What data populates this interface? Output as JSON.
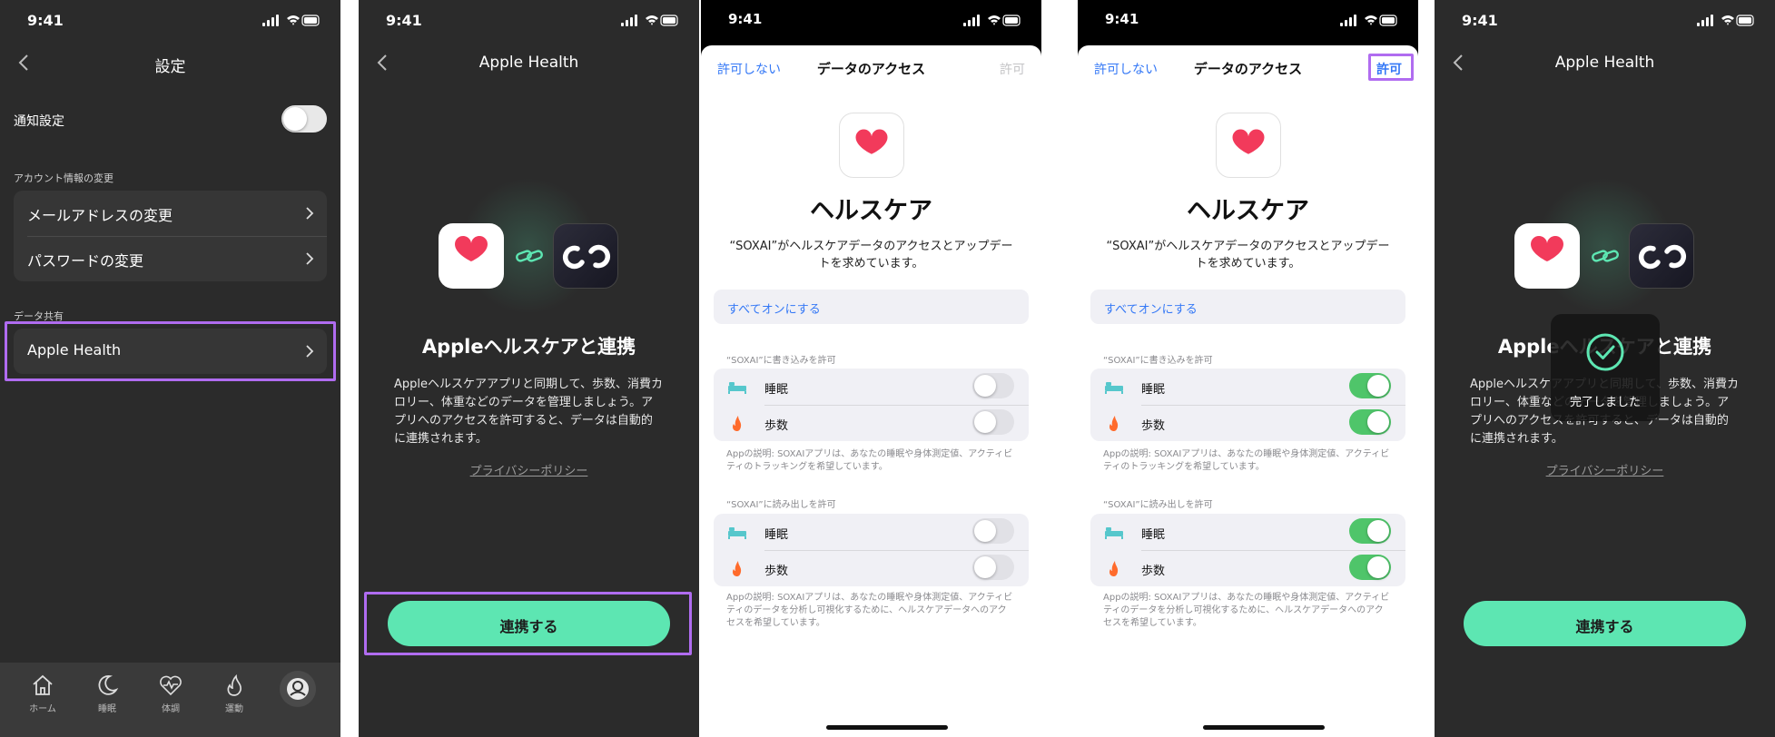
{
  "status": {
    "time": "9:41"
  },
  "colors": {
    "accent_green": "#5de6b2",
    "highlight": "#b06cf0",
    "ios_blue": "#3478f6",
    "switch_on": "#4fc56a"
  },
  "screen1": {
    "title": "設定",
    "notification_label": "通知設定",
    "notification_on": false,
    "account_section": "アカウント情報の変更",
    "email_change": "メールアドレスの変更",
    "password_change": "パスワードの変更",
    "data_share_section": "データ共有",
    "apple_health": "Apple Health",
    "tabs": [
      {
        "label": "ホーム",
        "icon": "home-icon"
      },
      {
        "label": "睡眠",
        "icon": "moon-icon"
      },
      {
        "label": "体調",
        "icon": "heart-pulse-icon"
      },
      {
        "label": "運動",
        "icon": "flame-icon"
      },
      {
        "label": "",
        "icon": "profile-icon"
      }
    ]
  },
  "link_screen": {
    "title": "Apple Health",
    "heading": "Appleヘルスケアと連携",
    "description": "Appleヘルスケアアプリと同期して、歩数、消費カロリー、体重などのデータを管理しましょう。アプリへのアクセスを許可すると、データは自動的に連携されます。",
    "privacy": "プライバシーポリシー",
    "button": "連携する"
  },
  "access_sheet": {
    "deny": "許可しない",
    "title": "データのアクセス",
    "allow": "許可",
    "app_title": "ヘルスケア",
    "subtitle": "“SOXAI”がヘルスケアデータのアクセスとアップデートを求めています。",
    "turn_all_on": "すべてオンにする",
    "write_header": "“SOXAI”に書き込みを許可",
    "read_header": "“SOXAI”に読み出しを許可",
    "sleep": "睡眠",
    "steps": "歩数",
    "write_note": "Appの説明: SOXAIアプリは、あなたの睡眠や身体測定値、アクティビティのトラッキングを希望しています。",
    "read_note": "Appの説明: SOXAIアプリは、あなたの睡眠や身体測定値、アクティビティのデータを分析し可視化するために、ヘルスケアデータへのアクセスを希望しています。"
  },
  "done_toast": {
    "text": "完了しました"
  }
}
